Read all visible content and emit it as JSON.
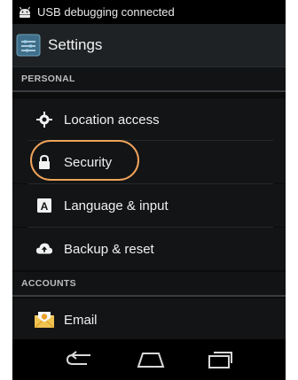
{
  "status_bar": {
    "notification": "USB debugging connected",
    "icon": "android-icon"
  },
  "action_bar": {
    "title": "Settings",
    "icon": "settings-app-icon"
  },
  "sections": {
    "personal": "PERSONAL",
    "accounts": "ACCOUNTS"
  },
  "items": [
    {
      "label": "Location access",
      "icon": "location-icon"
    },
    {
      "label": "Security",
      "icon": "lock-icon",
      "highlighted": true
    },
    {
      "label": "Language & input",
      "icon": "keyboard-icon"
    },
    {
      "label": "Backup & reset",
      "icon": "cloud-upload-icon"
    },
    {
      "label": "Email",
      "icon": "email-icon"
    }
  ],
  "nav_bar": {
    "buttons": [
      "back-icon",
      "home-icon",
      "recent-apps-icon"
    ]
  },
  "colors": {
    "highlight": "#f0a35a",
    "background": "#121415"
  }
}
